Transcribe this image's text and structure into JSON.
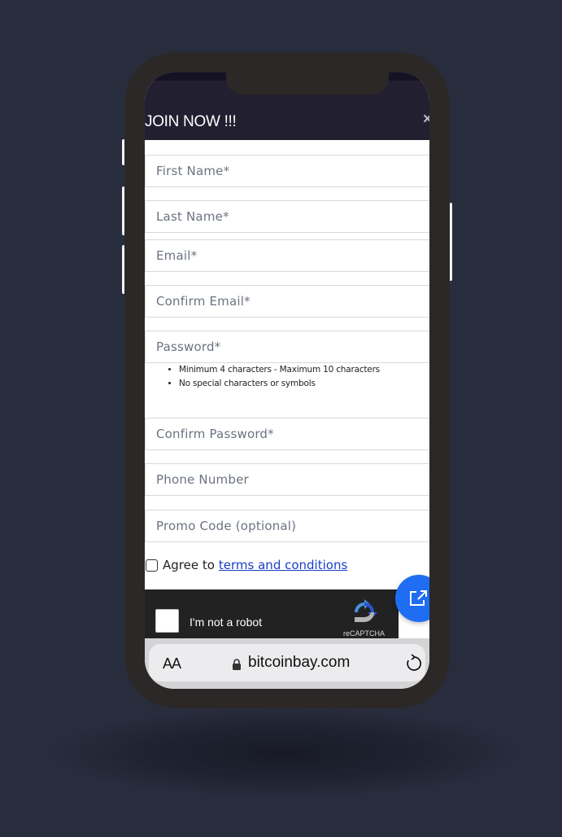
{
  "modal": {
    "title": "JOIN NOW !!!",
    "close_label": "×"
  },
  "form": {
    "first_name_placeholder": "First Name*",
    "last_name_placeholder": "Last Name*",
    "email_placeholder": "Email*",
    "confirm_email_placeholder": "Confirm Email*",
    "password_placeholder": "Password*",
    "password_hints": [
      "Minimum 4 characters - Maximum 10 characters",
      "No special characters or symbols"
    ],
    "confirm_password_placeholder": "Confirm Password*",
    "phone_placeholder": "Phone Number",
    "promo_placeholder": "Promo Code (optional)",
    "terms_prefix": "Agree to",
    "terms_link": "terms and conditions"
  },
  "captcha": {
    "label": "I'm not a robot",
    "brand": "reCAPTCHA"
  },
  "browser": {
    "text_size_label": "AA",
    "url": "bitcoinbay.com",
    "icons": [
      "lock-icon",
      "reload-icon",
      "external-link-icon"
    ]
  },
  "colors": {
    "background": "#282d3e",
    "phone_frame": "#2c2828",
    "header": "#221f30",
    "link": "#1a3dc8",
    "fab": "#1f6df2",
    "captcha_bg": "#222222"
  }
}
